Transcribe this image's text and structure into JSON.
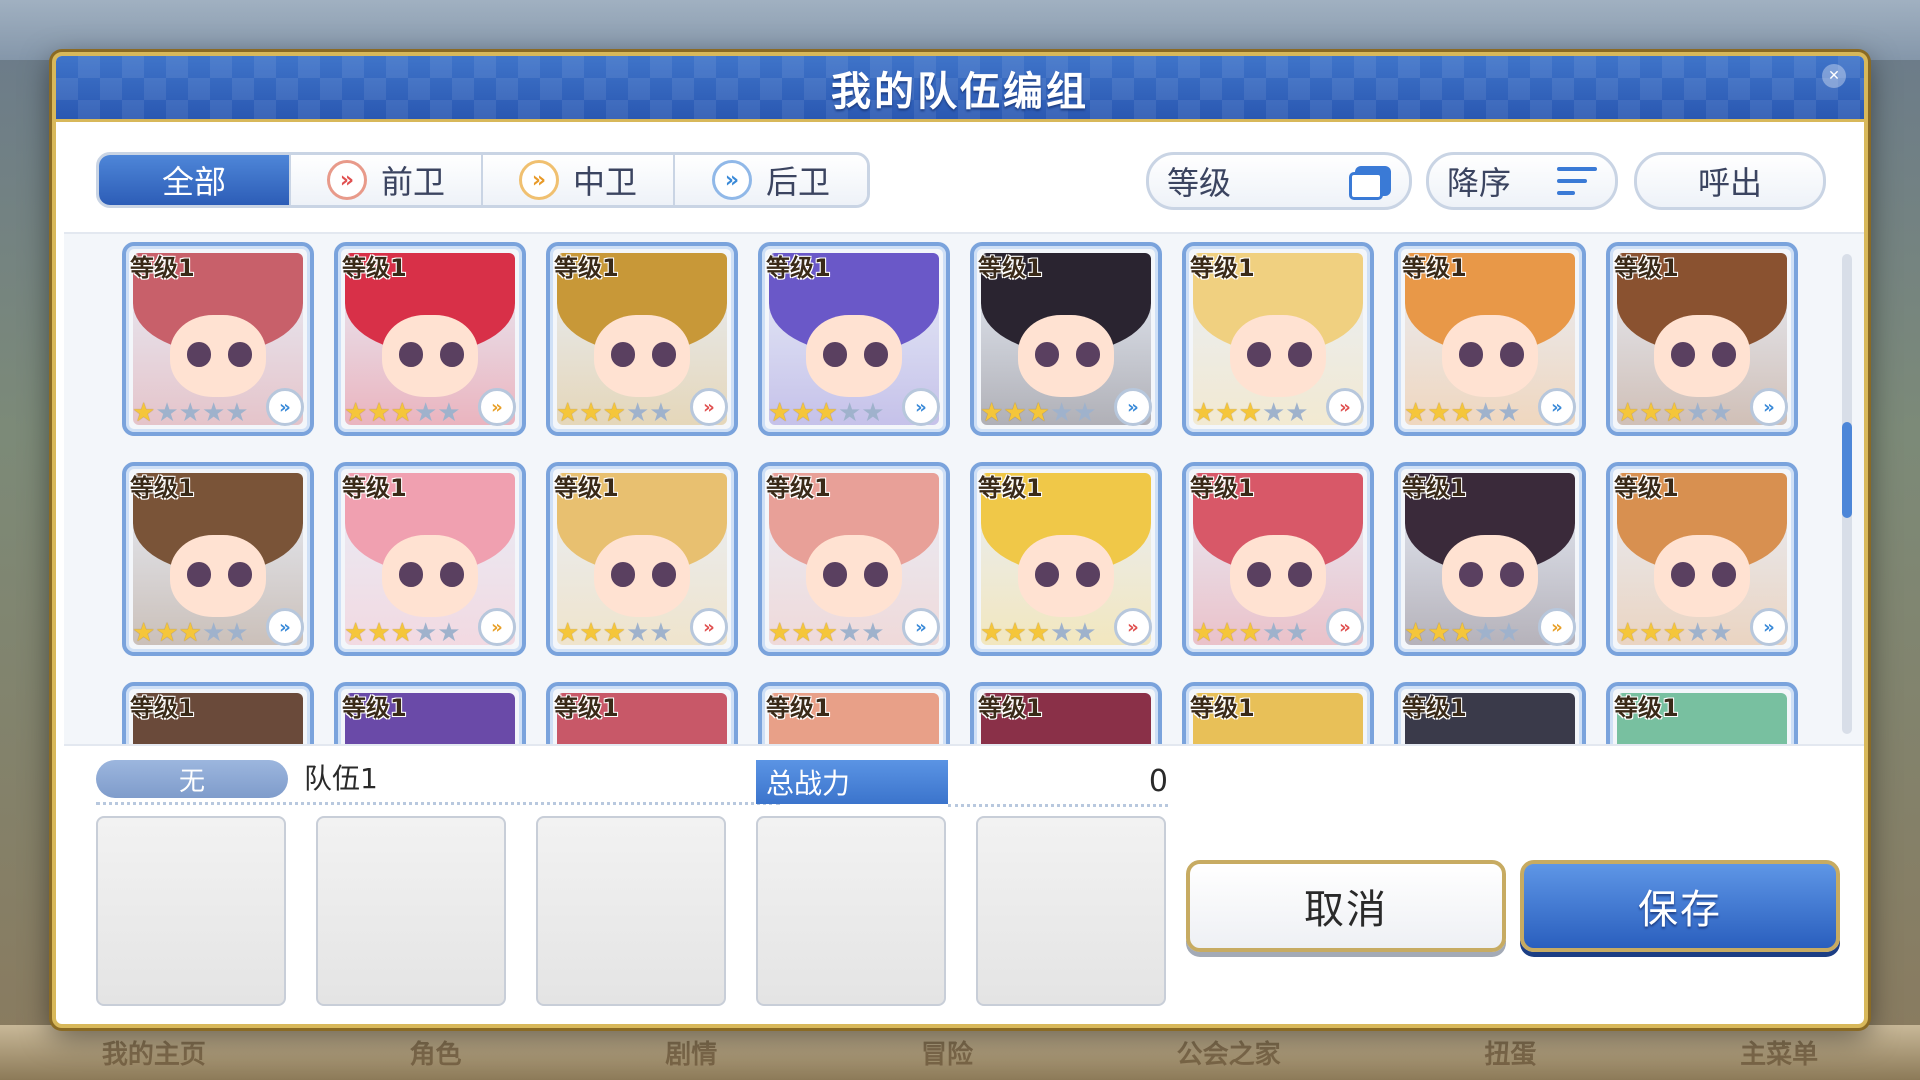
{
  "dialog": {
    "title": "我的队伍编组"
  },
  "tabs": [
    {
      "label": "全部",
      "icon": "none",
      "active": true
    },
    {
      "label": "前卫",
      "icon": "front-role-icon",
      "active": false
    },
    {
      "label": "中卫",
      "icon": "mid-role-icon",
      "active": false
    },
    {
      "label": "后卫",
      "icon": "back-role-icon",
      "active": false
    }
  ],
  "sort": {
    "field_label": "等级",
    "order_label": "降序",
    "callout_label": "呼出"
  },
  "characters": [
    {
      "level": "等级1",
      "stars": 1,
      "role": "back",
      "hair": "#c8606a"
    },
    {
      "level": "等级1",
      "stars": 3,
      "role": "mid",
      "hair": "#d83048"
    },
    {
      "level": "等级1",
      "stars": 3,
      "role": "front",
      "hair": "#c89838"
    },
    {
      "level": "等级1",
      "stars": 3,
      "role": "back",
      "hair": "#6a58c8"
    },
    {
      "level": "等级1",
      "stars": 3,
      "role": "back",
      "hair": "#2a2430"
    },
    {
      "level": "等级1",
      "stars": 3,
      "role": "front",
      "hair": "#f0d080"
    },
    {
      "level": "等级1",
      "stars": 3,
      "role": "back",
      "hair": "#e89848"
    },
    {
      "level": "等级1",
      "stars": 3,
      "role": "back",
      "hair": "#8a5230"
    },
    {
      "level": "等级1",
      "stars": 3,
      "role": "back",
      "hair": "#7a5438"
    },
    {
      "level": "等级1",
      "stars": 3,
      "role": "mid",
      "hair": "#f0a0b0"
    },
    {
      "level": "等级1",
      "stars": 3,
      "role": "front",
      "hair": "#e8c070"
    },
    {
      "level": "等级1",
      "stars": 3,
      "role": "back",
      "hair": "#e8a098"
    },
    {
      "level": "等级1",
      "stars": 3,
      "role": "front",
      "hair": "#f0c848"
    },
    {
      "level": "等级1",
      "stars": 3,
      "role": "front",
      "hair": "#d85868"
    },
    {
      "level": "等级1",
      "stars": 3,
      "role": "mid",
      "hair": "#3a2a3a"
    },
    {
      "level": "等级1",
      "stars": 3,
      "role": "back",
      "hair": "#d89050"
    },
    {
      "level": "等级1",
      "stars": 0,
      "role": "none",
      "hair": "#6a4a3a"
    },
    {
      "level": "等级1",
      "stars": 0,
      "role": "none",
      "hair": "#6a4aa8"
    },
    {
      "level": "等级1",
      "stars": 0,
      "role": "none",
      "hair": "#c85868"
    },
    {
      "level": "等级1",
      "stars": 0,
      "role": "none",
      "hair": "#e8a088"
    },
    {
      "level": "等级1",
      "stars": 0,
      "role": "none",
      "hair": "#8a3048"
    },
    {
      "level": "等级1",
      "stars": 0,
      "role": "none",
      "hair": "#e8c058"
    },
    {
      "level": "等级1",
      "stars": 0,
      "role": "none",
      "hair": "#3a3a4a"
    },
    {
      "level": "等级1",
      "stars": 0,
      "role": "none",
      "hair": "#78c0a0"
    }
  ],
  "team": {
    "tag": "无",
    "name": "队伍1",
    "power_label": "总战力",
    "power_value": "0"
  },
  "slots": [
    {},
    {},
    {},
    {},
    {}
  ],
  "buttons": {
    "cancel": "取消",
    "save": "保存"
  },
  "background_nav": [
    "我的主页",
    "角色",
    "剧情",
    "冒险",
    "公会之家",
    "扭蛋",
    "主菜单"
  ]
}
